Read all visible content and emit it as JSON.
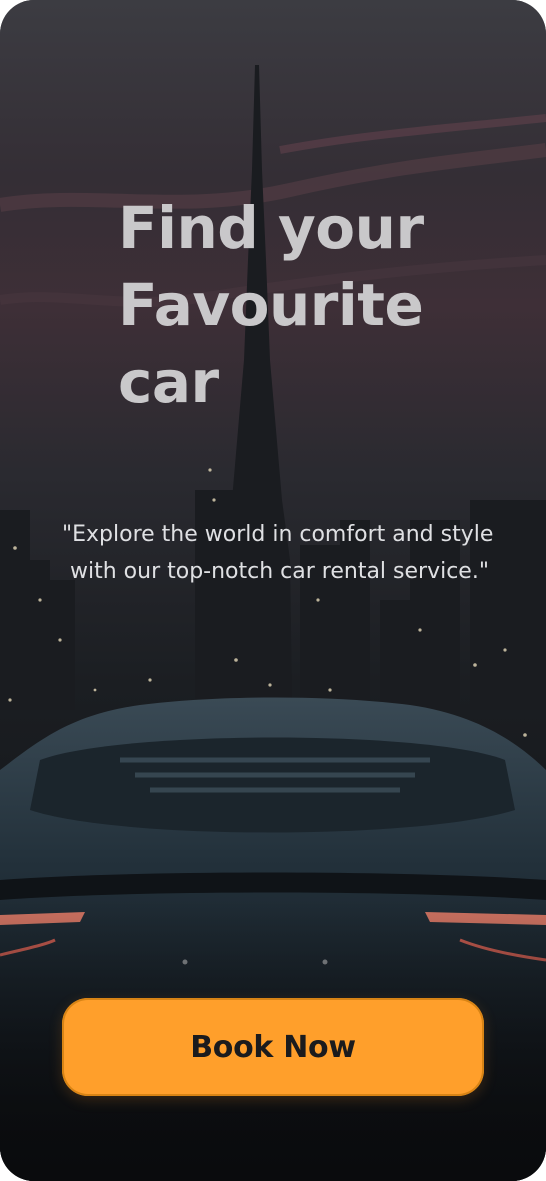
{
  "hero": {
    "title_lines": [
      "Find your",
      "Favourite",
      "car"
    ],
    "tagline": "\"Explore the world in comfort and style with our top-notch car rental service.\""
  },
  "cta": {
    "label": "Book Now"
  },
  "colors": {
    "accent": "#ff9f2b",
    "title": "#c9c8ca",
    "tagline": "#dfe0e3",
    "button_text": "#1b1b1d"
  },
  "background": {
    "image_subject": "city-skyline-with-sports-car-photo"
  }
}
